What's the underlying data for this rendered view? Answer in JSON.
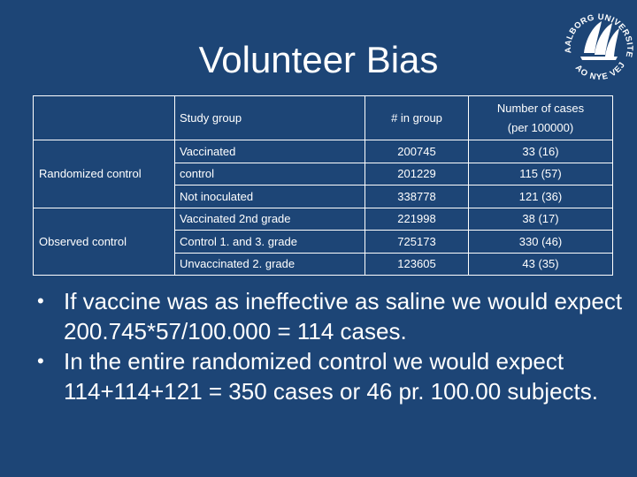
{
  "slide": {
    "title": "Volunteer Bias",
    "logo_icon": "aalborg-university-logo",
    "logo_text": "AALBORG UNIVERSITET · AO NYE VEJE"
  },
  "table": {
    "headers": {
      "group": "",
      "study_group": "Study group",
      "in_group": "# in group",
      "cases_line1": "Number of cases",
      "cases_line2": "(per 100000)"
    },
    "sections": [
      {
        "label": "Randomized control",
        "rows": [
          {
            "study_group": "Vaccinated",
            "in_group": "200745",
            "cases": "33 (16)"
          },
          {
            "study_group": "control",
            "in_group": "201229",
            "cases": "115 (57)"
          },
          {
            "study_group": "Not inoculated",
            "in_group": "338778",
            "cases": "121 (36)"
          }
        ]
      },
      {
        "label": "Observed control",
        "rows": [
          {
            "study_group": "Vaccinated 2nd grade",
            "in_group": "221998",
            "cases": "38 (17)"
          },
          {
            "study_group": "Control 1. and 3. grade",
            "in_group": "725173",
            "cases": "330 (46)"
          },
          {
            "study_group": "Unvaccinated 2. grade",
            "in_group": "123605",
            "cases": "43 (35)"
          }
        ]
      }
    ]
  },
  "bullets": [
    "If vaccine was as ineffective as saline we would expect 200.745*57/100.000 = 114 cases.",
    "In the entire randomized control we would expect 114+114+121 = 350 cases or 46 pr. 100.00 subjects."
  ],
  "bullet_glyph": "•"
}
